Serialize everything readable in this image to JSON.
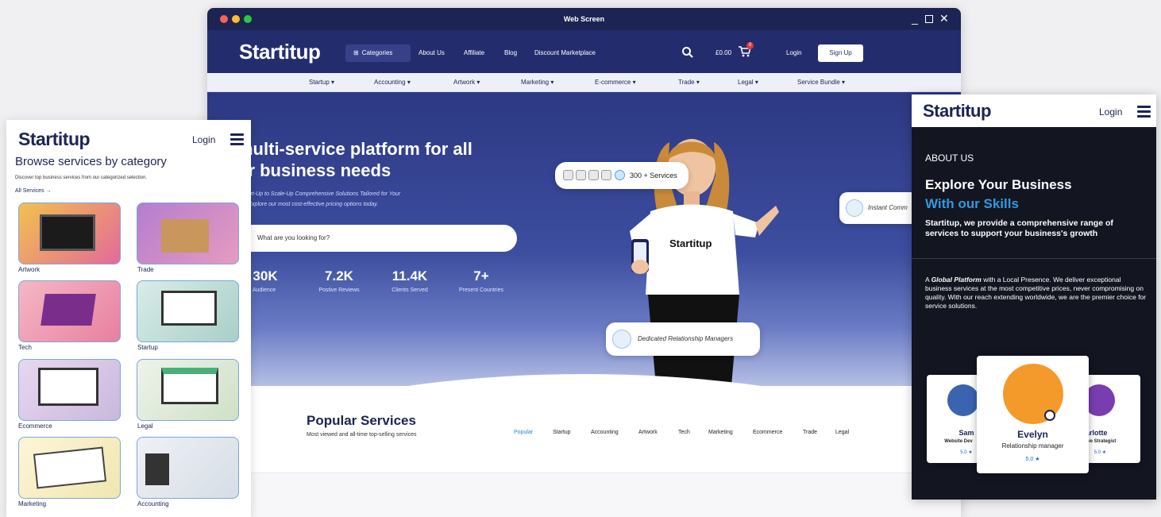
{
  "window": {
    "title": "Web Screen"
  },
  "nav": {
    "logo": "Startitup",
    "categories": "Categories",
    "links": [
      "About Us",
      "Affiliate",
      "Blog",
      "Discount Marketplace"
    ],
    "price": "£0.00",
    "cart_count": "0",
    "login": "Login",
    "signup": "Sign Up"
  },
  "category_bar": [
    "Startup",
    "Accounting",
    "Artwork",
    "Marketing",
    "E-commerce",
    "Trade",
    "Legal",
    "Service Bundle"
  ],
  "hero": {
    "title_line1": "multi-service platform for all",
    "title_line2": "ur business needs",
    "sub_line1": "Start-Up to Scale-Up Comprehensive Solutions Tailored for Your",
    "sub_line2": "s. Explore our most cost-effective pricing options today.",
    "search_placeholder": "What are you looking for?",
    "stats": [
      {
        "value": "30K",
        "label": "tal Audience"
      },
      {
        "value": "7.2K",
        "label": "Postive Reviews"
      },
      {
        "value": "11.4K",
        "label": "Clients Served"
      },
      {
        "value": "7+",
        "label": "Present Countries"
      }
    ],
    "services_pill": "300 + Services",
    "instant_pill": "Instant Comm",
    "relationship_pill": "Dedicated Relationship Managers",
    "shirt_text": "Startitup"
  },
  "popular": {
    "title": "Popular Services",
    "subtitle": "Most viewed and all-time top-selling services",
    "tabs": [
      "Popular",
      "Startup",
      "Accounting",
      "Artwork",
      "Tech",
      "Marketing",
      "Ecommerce",
      "Trade",
      "Legal"
    ]
  },
  "mobile_left": {
    "logo": "Startitup",
    "login": "Login",
    "title": "Browse services by category",
    "desc": "Discover top business services from our categorized selection.",
    "all_services": "All Services →",
    "cards": [
      "Artwork",
      "Trade",
      "Tech",
      "Startup",
      "Ecommerce",
      "Legal",
      "Marketing",
      "Accounting"
    ]
  },
  "mobile_right": {
    "logo": "Startitup",
    "login": "Login",
    "about": "ABOUT US",
    "heading1": "Explore Your Business",
    "heading2": "With our Skills",
    "intro": "Startitup, we provide a comprehensive range of services to support your business's growth",
    "body_bold": "Global Platform",
    "body_pre": "A ",
    "body_post": " with a Local Presence. We deliver exceptional business services at the most competitive prices, never compromising on quality. With our reach extending worldwide, we are the premier choice for service solutions.",
    "team": [
      {
        "name": "Sam",
        "role": "Website Dev",
        "rating": "5.0 ★"
      },
      {
        "name": "Evelyn",
        "role": "Relationship manager",
        "rating": "5.0 ★"
      },
      {
        "name": "harlotte",
        "role": "tive Strategist",
        "rating": "5.0 ★"
      }
    ]
  },
  "colors": {
    "navy": "#232d6e",
    "accent": "#2f9ae0",
    "dark": "#131521"
  }
}
